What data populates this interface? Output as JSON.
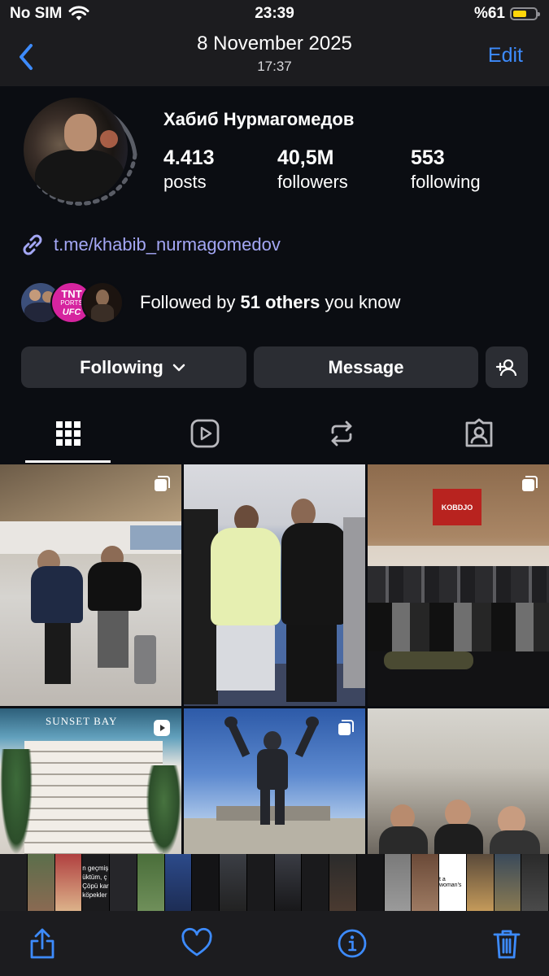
{
  "status_bar": {
    "carrier": "No SIM",
    "time": "23:39",
    "battery_percent": "%61",
    "battery_level": 0.61,
    "battery_color": "#ffd60a"
  },
  "photo_header": {
    "date": "8 November 2025",
    "time": "17:37",
    "edit_label": "Edit",
    "back_icon": "chevron-left-icon",
    "accent": "#3d8bfd"
  },
  "profile": {
    "name": "Хабиб Нурмагомедов",
    "stats": [
      {
        "value": "4.413",
        "label": "posts"
      },
      {
        "value": "40,5M",
        "label": "followers"
      },
      {
        "value": "553",
        "label": "following"
      }
    ],
    "link": "t.me/khabib_nurmagomedov",
    "link_color": "#a4a7f5",
    "followed_prefix": "Followed by ",
    "followed_count": "51 others",
    "followed_suffix": " you know",
    "mini_avatar_text": {
      "tnt": "TNT",
      "ports": "PORTS",
      "ufc": "UFC"
    }
  },
  "actions": {
    "following_label": "Following",
    "message_label": "Message"
  },
  "tabs": [
    {
      "icon": "grid-icon",
      "active": true
    },
    {
      "icon": "reels-icon",
      "active": false
    },
    {
      "icon": "repost-icon",
      "active": false
    },
    {
      "icon": "tagged-icon",
      "active": false
    }
  ],
  "posts": [
    {
      "scene": "airport",
      "badge": "carousel-icon"
    },
    {
      "scene": "gym",
      "badge": ""
    },
    {
      "scene": "team",
      "badge": "carousel-icon",
      "sign_text": "KOBDJO"
    },
    {
      "scene": "building",
      "badge": "reel-icon",
      "overlay_text": "SUNSET BAY"
    },
    {
      "scene": "statue",
      "badge": "carousel-icon"
    },
    {
      "scene": "group",
      "badge": ""
    }
  ],
  "filmstrip_texts": [
    "n geçmiş",
    "üktüm, ç",
    "Çöpü kar",
    "köpekler",
    "t a woman's"
  ],
  "toolbar": [
    {
      "icon": "share-icon"
    },
    {
      "icon": "heart-icon"
    },
    {
      "icon": "info-icon"
    },
    {
      "icon": "trash-icon"
    }
  ]
}
